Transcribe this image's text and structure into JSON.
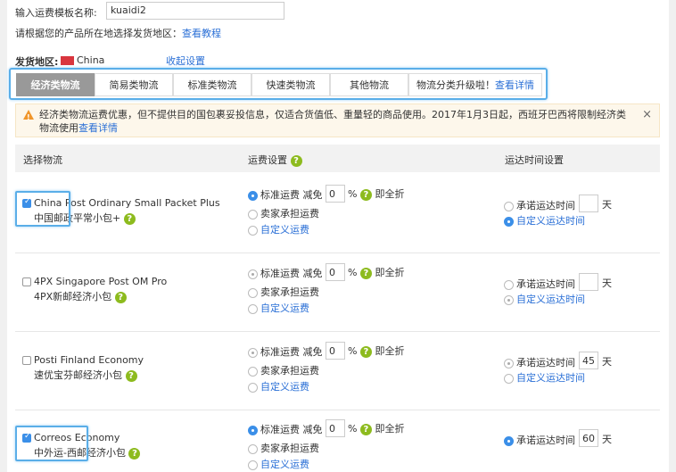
{
  "form": {
    "name_label": "输入运费模板名称:",
    "name_value": "kuaidi2",
    "hint": "请根据您的产品所在地选择发货地区：",
    "hint_link": "查看教程",
    "origin_label": "发货地区:",
    "origin_value": "China",
    "collapse_link": "收起设置"
  },
  "tabs": [
    "经济类物流",
    "简易类物流",
    "标准类物流",
    "快速类物流",
    "其他物流",
    "物流分类升级啦！"
  ],
  "tabs_link": "查看详情",
  "alert": {
    "text": "经济类物流运费优惠，但不提供目的国包裹妥投信息，仅适合货值低、重量轻的商品使用。2017年1月3日起，西班牙巴西将限制经济类物流使用",
    "link": "查看详情",
    "close": "×"
  },
  "table": {
    "col1": "选择物流",
    "col2": "运费设置",
    "col3": "运达时间设置"
  },
  "labels": {
    "standard": "标准运费 减免",
    "percent": "%",
    "full": "即全折",
    "seller": "卖家承担运费",
    "custom_fee": "自定义运费",
    "promise": "承诺运达时间",
    "days": "天",
    "custom_time": "自定义运达时间",
    "q": "?"
  },
  "rows": [
    {
      "name_en": "China Post Ordinary Small Packet Plus",
      "name_cn": "中国邮政平常小包+",
      "checked": true,
      "discount": "0",
      "days": "",
      "time_mode": "custom"
    },
    {
      "name_en": "4PX Singapore Post OM Pro",
      "name_cn": "4PX新邮经济小包",
      "checked": false,
      "discount": "0",
      "days": "",
      "time_mode": "custom"
    },
    {
      "name_en": "Posti Finland Economy",
      "name_cn": "速优宝芬邮经济小包",
      "checked": false,
      "discount": "0",
      "days": "45",
      "time_mode": "promise"
    },
    {
      "name_en": "Correos Economy",
      "name_cn": "中外运-西邮经济小包",
      "checked": true,
      "discount": "0",
      "days": "60",
      "time_mode": "promise"
    }
  ]
}
